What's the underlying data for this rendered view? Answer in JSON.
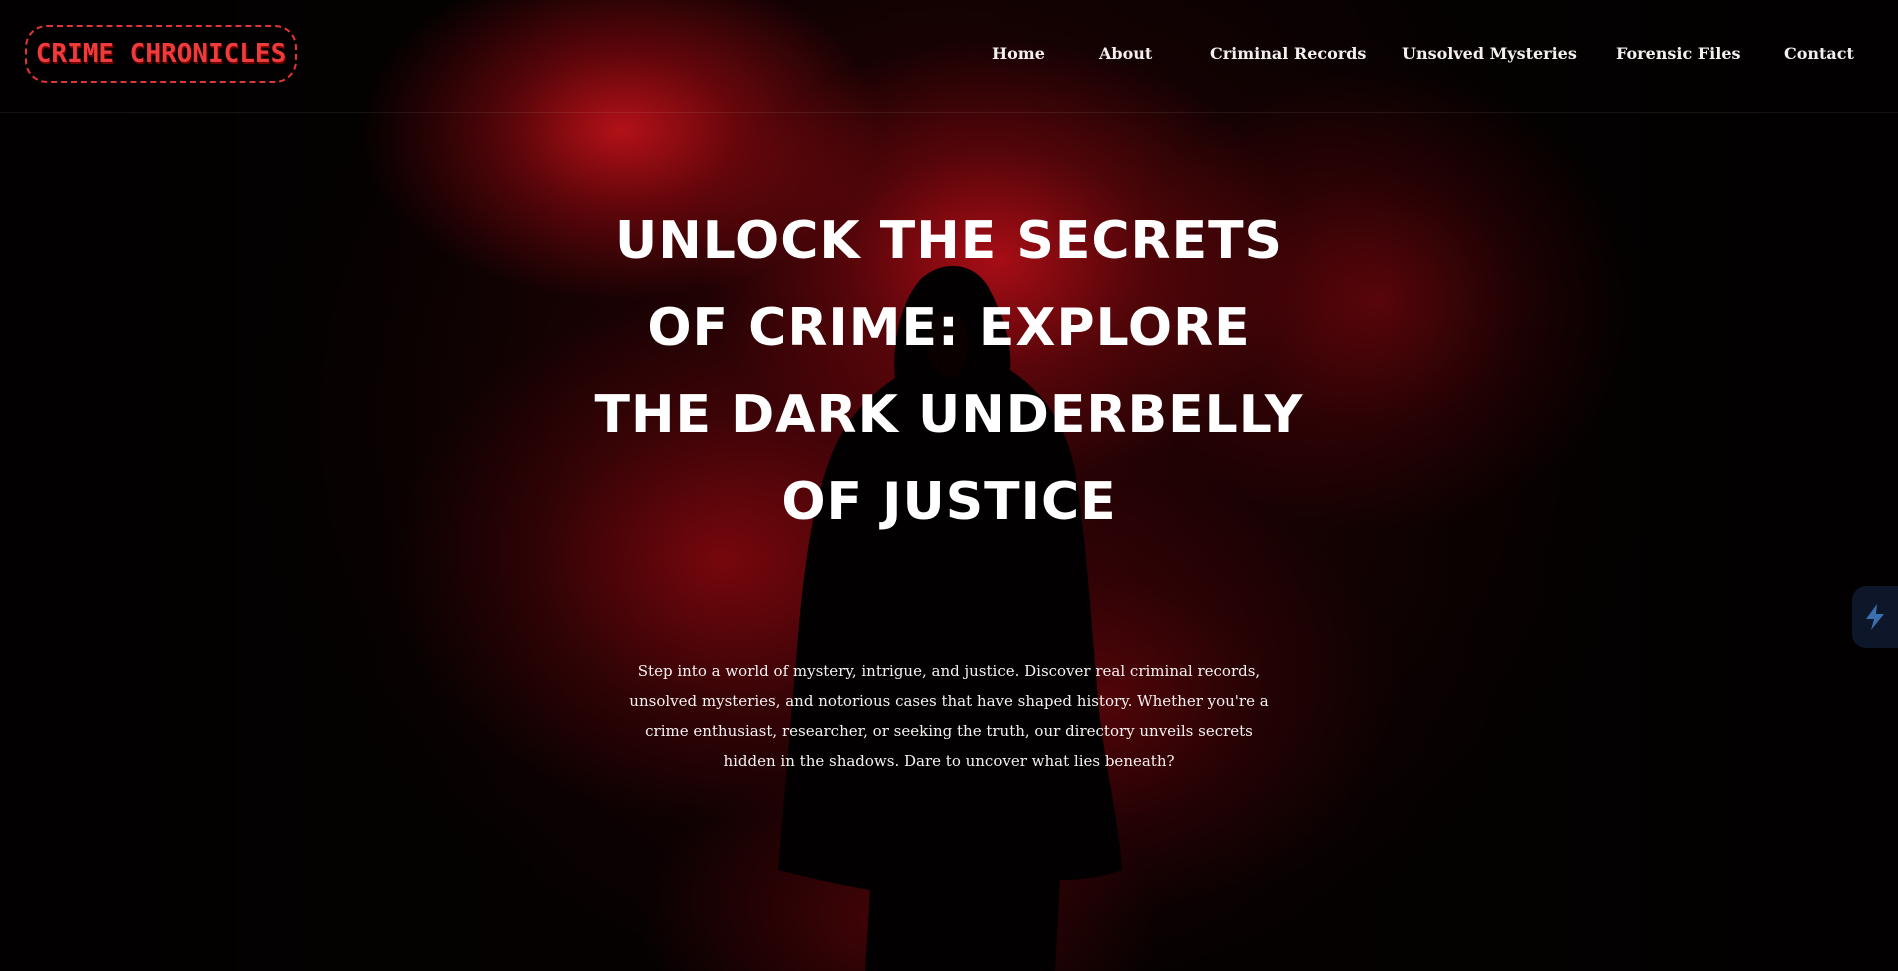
{
  "brand": {
    "logo_text": "CRIME CHRONICLES",
    "accent_color": "#e03636"
  },
  "nav": {
    "items": [
      {
        "label": "Home"
      },
      {
        "label": "About"
      },
      {
        "label": "Criminal Records"
      },
      {
        "label": "Unsolved Mysteries"
      },
      {
        "label": "Forensic Files"
      },
      {
        "label": "Contact"
      }
    ]
  },
  "hero": {
    "title": "UNLOCK THE SECRETS OF CRIME: EXPLORE THE DARK UNDERBELLY OF JUSTICE",
    "subtitle": "Step into a world of mystery, intrigue, and justice. Discover real criminal records, unsolved mysteries, and notorious cases that have shaped history. Whether you're a crime enthusiast, researcher, or seeking the truth, our directory unveils secrets hidden in the shadows. Dare to uncover what lies beneath?",
    "background": "hooded figure silhouetted against red smoke"
  },
  "side_widget": {
    "icon": "lightning-icon"
  }
}
